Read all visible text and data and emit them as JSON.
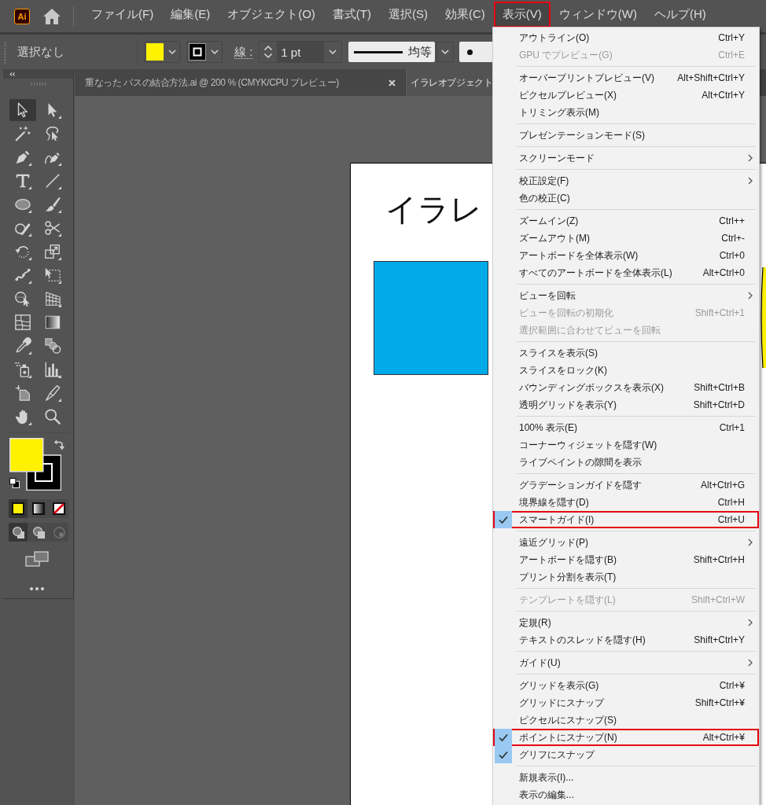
{
  "app": {
    "logo_text": "Ai"
  },
  "menu_bar": [
    {
      "label": "ファイル(F)",
      "selected": false,
      "highlighted": false
    },
    {
      "label": "編集(E)",
      "selected": false,
      "highlighted": false
    },
    {
      "label": "オブジェクト(O)",
      "selected": false,
      "highlighted": false
    },
    {
      "label": "書式(T)",
      "selected": false,
      "highlighted": false
    },
    {
      "label": "選択(S)",
      "selected": false,
      "highlighted": false
    },
    {
      "label": "効果(C)",
      "selected": false,
      "highlighted": false
    },
    {
      "label": "表示(V)",
      "selected": true,
      "highlighted": true
    },
    {
      "label": "ウィンドウ(W)",
      "selected": false,
      "highlighted": false
    },
    {
      "label": "ヘルプ(H)",
      "selected": false,
      "highlighted": false
    }
  ],
  "control_bar": {
    "selection_status": "選択なし",
    "stroke_label": "線 :",
    "stroke_weight": "1 pt",
    "stroke_profile": "均等"
  },
  "tabs": [
    {
      "label": "重なった パスの結合方法.ai @ 200 % (CMYK/CPU プレビュー)",
      "selected": false,
      "close_button": true
    },
    {
      "label": "イラレオブジェクト",
      "selected": true,
      "close_button": false
    }
  ],
  "toolbar": {
    "tools": [
      {
        "selected": true
      },
      {
        "selected": false
      },
      {
        "selected": false
      },
      {
        "selected": false
      },
      {
        "selected": false
      },
      {
        "selected": false
      },
      {
        "selected": false
      },
      {
        "selected": false
      },
      {
        "selected": false
      },
      {
        "selected": false
      },
      {
        "selected": false
      },
      {
        "selected": false
      },
      {
        "selected": false
      },
      {
        "selected": false
      },
      {
        "selected": false
      },
      {
        "selected": false
      },
      {
        "selected": false
      },
      {
        "selected": false
      },
      {
        "selected": false
      },
      {
        "selected": false
      },
      {
        "selected": false
      },
      {
        "selected": false
      },
      {
        "selected": false
      },
      {
        "selected": false
      },
      {
        "selected": false
      },
      {
        "selected": false
      },
      {
        "selected": false
      },
      {
        "selected": false
      }
    ],
    "color_modes": [
      {
        "selected": true
      },
      {
        "selected": false
      },
      {
        "selected": false
      }
    ],
    "draw_modes": [
      {
        "selected": true,
        "disabled": false
      },
      {
        "selected": false,
        "disabled": false
      },
      {
        "selected": false,
        "disabled": true
      }
    ]
  },
  "artboard": {
    "heading": "イラレ"
  },
  "view_menu": {
    "sections": [
      {
        "items": [
          {
            "label": "アウトライン(O)",
            "shortcut": "Ctrl+Y",
            "checked": false,
            "disabled": false,
            "submenu": false,
            "highlighted": false
          },
          {
            "label": "GPU でプレビュー(G)",
            "shortcut": "Ctrl+E",
            "checked": false,
            "disabled": true,
            "submenu": false,
            "highlighted": false
          }
        ]
      },
      {
        "items": [
          {
            "label": "オーバープリントプレビュー(V)",
            "shortcut": "Alt+Shift+Ctrl+Y",
            "checked": false,
            "disabled": false,
            "submenu": false,
            "highlighted": false
          },
          {
            "label": "ピクセルプレビュー(X)",
            "shortcut": "Alt+Ctrl+Y",
            "checked": false,
            "disabled": false,
            "submenu": false,
            "highlighted": false
          },
          {
            "label": "トリミング表示(M)",
            "checked": false,
            "disabled": false,
            "submenu": false,
            "highlighted": false
          }
        ]
      },
      {
        "items": [
          {
            "label": "プレゼンテーションモード(S)",
            "checked": false,
            "disabled": false,
            "submenu": false,
            "highlighted": false
          }
        ]
      },
      {
        "items": [
          {
            "label": "スクリーンモード",
            "checked": false,
            "disabled": false,
            "submenu": true,
            "highlighted": false
          }
        ]
      },
      {
        "items": [
          {
            "label": "校正設定(F)",
            "checked": false,
            "disabled": false,
            "submenu": true,
            "highlighted": false
          },
          {
            "label": "色の校正(C)",
            "checked": false,
            "disabled": false,
            "submenu": false,
            "highlighted": false
          }
        ]
      },
      {
        "items": [
          {
            "label": "ズームイン(Z)",
            "shortcut": "Ctrl++",
            "checked": false,
            "disabled": false,
            "submenu": false,
            "highlighted": false
          },
          {
            "label": "ズームアウト(M)",
            "shortcut": "Ctrl+-",
            "checked": false,
            "disabled": false,
            "submenu": false,
            "highlighted": false
          },
          {
            "label": "アートボードを全体表示(W)",
            "shortcut": "Ctrl+0",
            "checked": false,
            "disabled": false,
            "submenu": false,
            "highlighted": false
          },
          {
            "label": "すべてのアートボードを全体表示(L)",
            "shortcut": "Alt+Ctrl+0",
            "checked": false,
            "disabled": false,
            "submenu": false,
            "highlighted": false
          }
        ]
      },
      {
        "items": [
          {
            "label": "ビューを回転",
            "checked": false,
            "disabled": false,
            "submenu": true,
            "highlighted": false
          },
          {
            "label": "ビューを回転の初期化",
            "shortcut": "Shift+Ctrl+1",
            "checked": false,
            "disabled": true,
            "submenu": false,
            "highlighted": false
          },
          {
            "label": "選択範囲に合わせてビューを回転",
            "checked": false,
            "disabled": true,
            "submenu": false,
            "highlighted": false
          }
        ]
      },
      {
        "items": [
          {
            "label": "スライスを表示(S)",
            "checked": false,
            "disabled": false,
            "submenu": false,
            "highlighted": false
          },
          {
            "label": "スライスをロック(K)",
            "checked": false,
            "disabled": false,
            "submenu": false,
            "highlighted": false
          },
          {
            "label": "バウンディングボックスを表示(X)",
            "shortcut": "Shift+Ctrl+B",
            "checked": false,
            "disabled": false,
            "submenu": false,
            "highlighted": false
          },
          {
            "label": "透明グリッドを表示(Y)",
            "shortcut": "Shift+Ctrl+D",
            "checked": false,
            "disabled": false,
            "submenu": false,
            "highlighted": false
          }
        ]
      },
      {
        "items": [
          {
            "label": "100% 表示(E)",
            "shortcut": "Ctrl+1",
            "checked": false,
            "disabled": false,
            "submenu": false,
            "highlighted": false
          },
          {
            "label": "コーナーウィジェットを隠す(W)",
            "checked": false,
            "disabled": false,
            "submenu": false,
            "highlighted": false
          },
          {
            "label": "ライブペイントの隙間を表示",
            "checked": false,
            "disabled": false,
            "submenu": false,
            "highlighted": false
          }
        ]
      },
      {
        "items": [
          {
            "label": "グラデーションガイドを隠す",
            "shortcut": "Alt+Ctrl+G",
            "checked": false,
            "disabled": false,
            "submenu": false,
            "highlighted": false
          },
          {
            "label": "境界線を隠す(D)",
            "shortcut": "Ctrl+H",
            "checked": false,
            "disabled": false,
            "submenu": false,
            "highlighted": false
          },
          {
            "label": "スマートガイド(I)",
            "shortcut": "Ctrl+U",
            "checked": true,
            "disabled": false,
            "submenu": false,
            "highlighted": true
          }
        ]
      },
      {
        "items": [
          {
            "label": "遠近グリッド(P)",
            "checked": false,
            "disabled": false,
            "submenu": true,
            "highlighted": false
          },
          {
            "label": "アートボードを隠す(B)",
            "shortcut": "Shift+Ctrl+H",
            "checked": false,
            "disabled": false,
            "submenu": false,
            "highlighted": false
          },
          {
            "label": "プリント分割を表示(T)",
            "checked": false,
            "disabled": false,
            "submenu": false,
            "highlighted": false
          }
        ]
      },
      {
        "items": [
          {
            "label": "テンプレートを隠す(L)",
            "shortcut": "Shift+Ctrl+W",
            "checked": false,
            "disabled": true,
            "submenu": false,
            "highlighted": false
          }
        ]
      },
      {
        "items": [
          {
            "label": "定規(R)",
            "checked": false,
            "disabled": false,
            "submenu": true,
            "highlighted": false
          },
          {
            "label": "テキストのスレッドを隠す(H)",
            "shortcut": "Shift+Ctrl+Y",
            "checked": false,
            "disabled": false,
            "submenu": false,
            "highlighted": false
          }
        ]
      },
      {
        "items": [
          {
            "label": "ガイド(U)",
            "checked": false,
            "disabled": false,
            "submenu": true,
            "highlighted": false
          }
        ]
      },
      {
        "items": [
          {
            "label": "グリッドを表示(G)",
            "shortcut": "Ctrl+¥",
            "checked": false,
            "disabled": false,
            "submenu": false,
            "highlighted": false
          },
          {
            "label": "グリッドにスナップ",
            "shortcut": "Shift+Ctrl+¥",
            "checked": false,
            "disabled": false,
            "submenu": false,
            "highlighted": false
          },
          {
            "label": "ピクセルにスナップ(S)",
            "checked": false,
            "disabled": false,
            "submenu": false,
            "highlighted": false
          },
          {
            "label": "ポイントにスナップ(N)",
            "shortcut": "Alt+Ctrl+¥",
            "checked": true,
            "disabled": false,
            "submenu": false,
            "highlighted": true
          },
          {
            "label": "グリフにスナップ",
            "checked": true,
            "disabled": false,
            "submenu": false,
            "highlighted": false
          }
        ]
      },
      {
        "items": [
          {
            "label": "新規表示(I)...",
            "checked": false,
            "disabled": false,
            "submenu": false,
            "highlighted": false
          },
          {
            "label": "表示の編集...",
            "checked": false,
            "disabled": false,
            "submenu": false,
            "highlighted": false
          }
        ]
      }
    ]
  }
}
